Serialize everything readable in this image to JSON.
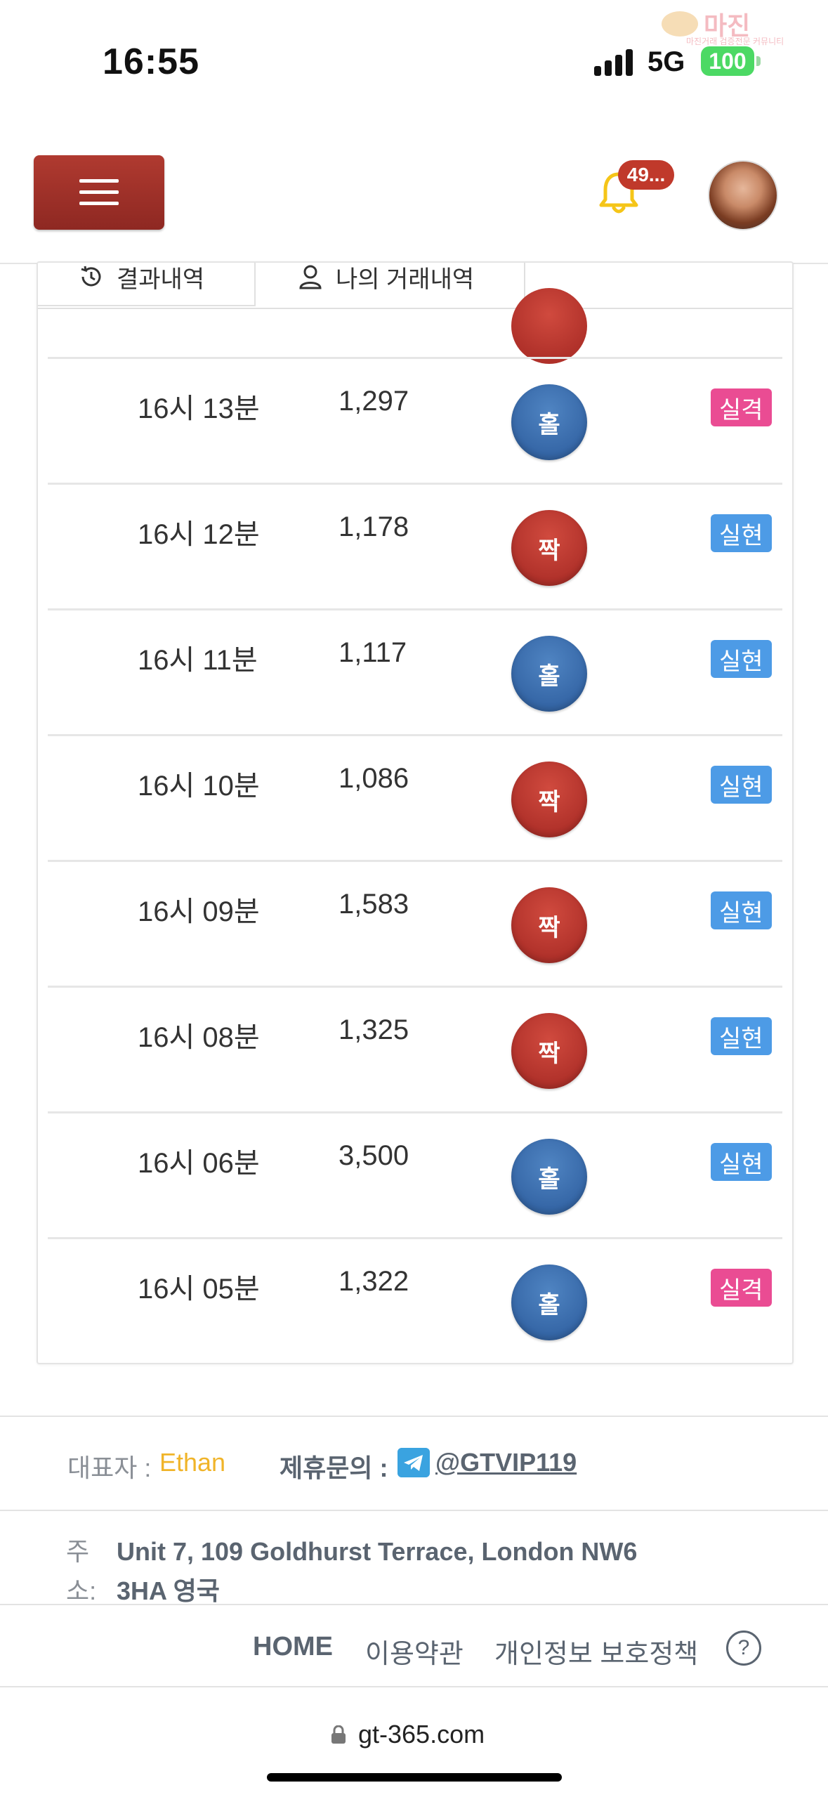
{
  "status_bar": {
    "time": "16:55",
    "network": "5G",
    "battery": "100",
    "watermark_title": "마진",
    "watermark_subtitle": "마진거래 검증전문 커뮤니티"
  },
  "header": {
    "menu_icon": "hamburger-icon",
    "notification_icon": "bell-icon",
    "notification_count": "49..."
  },
  "tabs": [
    {
      "label": "결과내역",
      "icon": "history-icon"
    },
    {
      "label": "나의 거래내역",
      "icon": "user-icon"
    }
  ],
  "rows": [
    {
      "time": "16시 13분",
      "value": "1,297",
      "result": "홀",
      "status": "실격"
    },
    {
      "time": "16시 12분",
      "value": "1,178",
      "result": "짝",
      "status": "실현"
    },
    {
      "time": "16시 11분",
      "value": "1,117",
      "result": "홀",
      "status": "실현"
    },
    {
      "time": "16시 10분",
      "value": "1,086",
      "result": "짝",
      "status": "실현"
    },
    {
      "time": "16시 09분",
      "value": "1,583",
      "result": "짝",
      "status": "실현"
    },
    {
      "time": "16시 08분",
      "value": "1,325",
      "result": "짝",
      "status": "실현"
    },
    {
      "time": "16시 06분",
      "value": "3,500",
      "result": "홀",
      "status": "실현"
    },
    {
      "time": "16시 05분",
      "value": "1,322",
      "result": "홀",
      "status": "실격"
    }
  ],
  "colors": {
    "odd_ball": "#3566a6",
    "even_ball": "#b0312a",
    "win_badge": "#4d9be6",
    "lose_badge": "#ea4c93",
    "menu_button": "#9e3027",
    "rep_name": "#f0b429"
  },
  "footer": {
    "rep_label": "대표자 :",
    "rep_name": "Ethan",
    "contact_label": "제휴문의 :",
    "contact_handle": "@GTVIP119",
    "address_label": "주 소:",
    "address": "Unit 7, 109 Goldhurst Terrace, London NW6 3HA 영국",
    "links": [
      "HOME",
      "이용약관",
      "개인정보 보호정책"
    ],
    "help": "?"
  },
  "browser": {
    "url": "gt-365.com"
  }
}
